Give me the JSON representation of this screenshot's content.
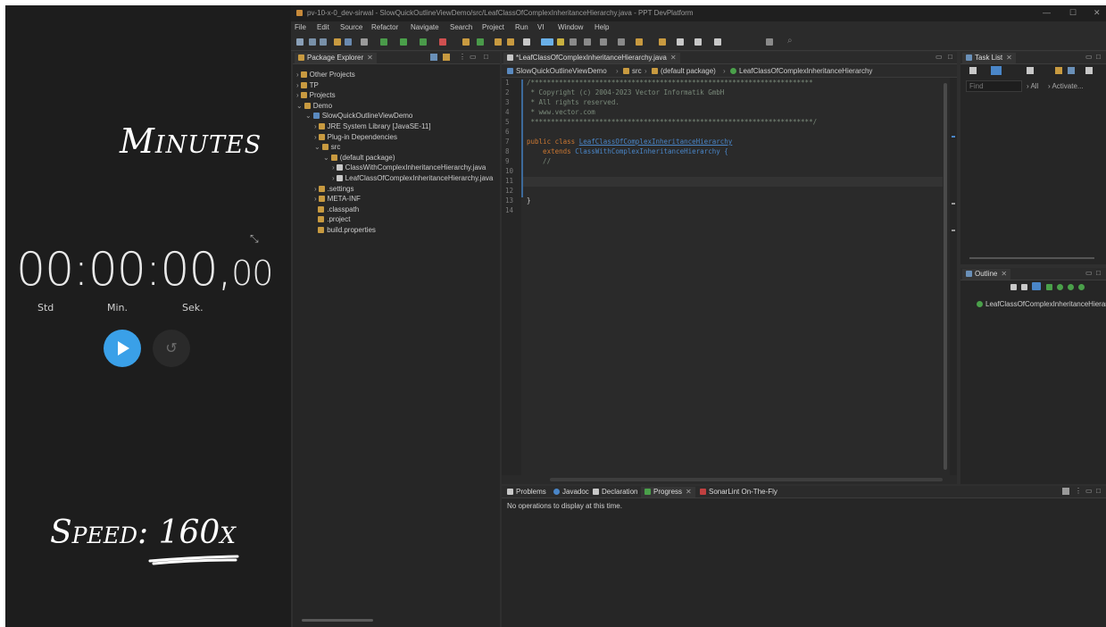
{
  "overlay": {
    "minutes_label": "Minutes",
    "time_main": "00:00:00,",
    "time_fraction": "00",
    "units": [
      "Std",
      "Min.",
      "Sek."
    ],
    "speed_label": "Speed: 160x",
    "accent_color": "#3aa0e8"
  },
  "window": {
    "title": "pv-10-x-0_dev-sirwal - SlowQuickOutlineViewDemo/src/LeafClassOfComplexInheritanceHierarchy.java - PPT DevPlatform"
  },
  "menu": [
    "File",
    "Edit",
    "Source",
    "Refactor",
    "Navigate",
    "Search",
    "Project",
    "Run",
    "VI",
    "Window",
    "Help"
  ],
  "package_explorer": {
    "tab_label": "Package Explorer",
    "tree": [
      {
        "label": "Other Projects",
        "indent": 0,
        "arrow": ">"
      },
      {
        "label": "TP",
        "indent": 0,
        "arrow": ">"
      },
      {
        "label": "Projects",
        "indent": 0,
        "arrow": ">"
      },
      {
        "label": "Demo",
        "indent": 0,
        "arrow": "v"
      },
      {
        "label": "SlowQuickOutlineViewDemo",
        "indent": 1,
        "arrow": "v"
      },
      {
        "label": "JRE System Library [JavaSE-11]",
        "indent": 2,
        "arrow": ">"
      },
      {
        "label": "Plug-in Dependencies",
        "indent": 2,
        "arrow": ">"
      },
      {
        "label": "src",
        "indent": 2,
        "arrow": "v"
      },
      {
        "label": "(default package)",
        "indent": 3,
        "arrow": "v"
      },
      {
        "label": "ClassWithComplexInheritanceHierarchy.java",
        "indent": 4,
        "arrow": ">"
      },
      {
        "label": "LeafClassOfComplexInheritanceHierarchy.java",
        "indent": 4,
        "arrow": ">"
      },
      {
        "label": ".settings",
        "indent": 2,
        "arrow": ">"
      },
      {
        "label": "META-INF",
        "indent": 2,
        "arrow": ">"
      },
      {
        "label": ".classpath",
        "indent": 2,
        "arrow": ""
      },
      {
        "label": ".project",
        "indent": 2,
        "arrow": ""
      },
      {
        "label": "build.properties",
        "indent": 2,
        "arrow": ""
      }
    ]
  },
  "editor": {
    "tab_label": "*LeafClassOfComplexInheritanceHierarchy.java",
    "breadcrumb": [
      "SlowQuickOutlineViewDemo",
      "src",
      "(default package)",
      "LeafClassOfComplexInheritanceHierarchy"
    ],
    "line_numbers": [
      "1",
      "2",
      "3",
      "4",
      "5",
      "6",
      "7",
      "8",
      "9",
      "10",
      "11",
      "12",
      "13",
      "14"
    ],
    "lines": {
      "l1": "/**********************************************************************",
      "l2": " * Copyright (c) 2004-2023 Vector Informatik GmbH",
      "l3": " * All rights reserved.",
      "l4": " * www.vector.com",
      "l5": " **********************************************************************/",
      "l7_kw": "public class ",
      "l7_cls": "LeafClassOfComplexInheritanceHierarchy",
      "l8_kw": "    extends ",
      "l8_cls": "ClassWithComplexInheritanceHierarchy {",
      "l9": "    //",
      "l13": "}"
    }
  },
  "task_list": {
    "tab_label": "Task List",
    "filter_placeholder": "Find",
    "all_label": "All",
    "activate_label": "Activate..."
  },
  "outline": {
    "tab_label": "Outline",
    "item": "LeafClassOfComplexInheritanceHierarchy"
  },
  "bottom": {
    "tabs": [
      "Problems",
      "Javadoc",
      "Declaration",
      "Progress",
      "SonarLint On-The-Fly"
    ],
    "message": "No operations to display at this time."
  }
}
